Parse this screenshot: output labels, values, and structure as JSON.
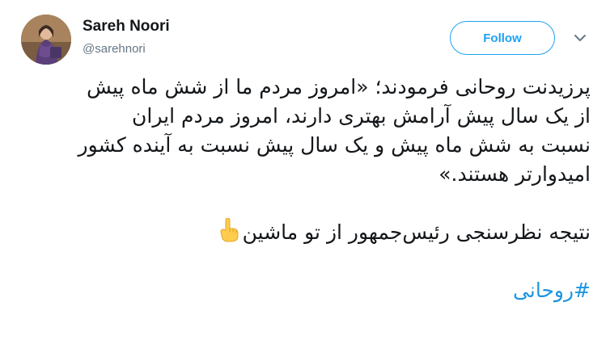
{
  "user": {
    "display_name": "Sareh Noori",
    "handle": "@sarehnori"
  },
  "actions": {
    "follow_label": "Follow"
  },
  "tweet": {
    "lines_para1": [
      "پرزیدنت روحانی فرمودند؛ «امروز مردم ما از شش ماه پیش",
      "از یک سال پیش آرامش بهتری دارند، امروز مردم ایران",
      "نسبت به شش ماه پیش و یک سال پیش نسبت به آینده کشور",
      "امیدوارتر هستند.»"
    ],
    "para2": "نتیجه نظرسنجی رئیس‌جمهور از تو ماشین",
    "hashtag": "#روحانی"
  },
  "icons": {
    "emoji": "backhand-index-pointing-up-emoji",
    "caret": "chevron-down-icon"
  },
  "colors": {
    "accent": "#1da1f2",
    "hashtag": "#1b95e0",
    "text": "#14171a",
    "secondary_text": "#657786"
  }
}
